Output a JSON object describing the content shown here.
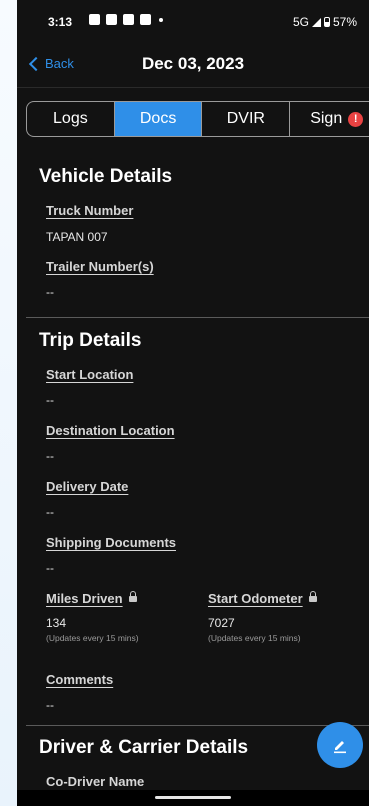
{
  "status_bar": {
    "time": "3:13",
    "network": "5G",
    "battery": "57%",
    "icons": [
      "teams-icon",
      "linkedin-icon",
      "shield-icon",
      "cast-icon",
      "notification-dot"
    ]
  },
  "nav": {
    "back_label": "Back",
    "title": "Dec 03, 2023"
  },
  "tabs": [
    {
      "label": "Logs",
      "active": false
    },
    {
      "label": "Docs",
      "active": true
    },
    {
      "label": "DVIR",
      "active": false
    },
    {
      "label": "Sign",
      "active": false,
      "alert": "!"
    }
  ],
  "vehicle": {
    "title": "Vehicle Details",
    "truck_label": "Truck Number",
    "truck_value": "TAPAN 007",
    "trailer_label": "Trailer Number(s)",
    "trailer_value": "--"
  },
  "trip": {
    "title": "Trip Details",
    "start_label": "Start Location",
    "start_value": "--",
    "dest_label": "Destination Location",
    "dest_value": "--",
    "delivery_label": "Delivery Date",
    "delivery_value": "--",
    "shipping_label": "Shipping Documents",
    "shipping_value": "--",
    "miles_label": "Miles Driven",
    "miles_value": "134",
    "miles_note": "(Updates every 15 mins)",
    "odometer_label": "Start Odometer",
    "odometer_value": "7027",
    "odometer_note": "(Updates every 15 mins)",
    "comments_label": "Comments",
    "comments_value": "--"
  },
  "driver": {
    "title": "Driver & Carrier Details",
    "codriver_label": "Co-Driver Name"
  },
  "colors": {
    "accent": "#2f8fe8",
    "background": "#121212",
    "alert": "#e94242"
  }
}
